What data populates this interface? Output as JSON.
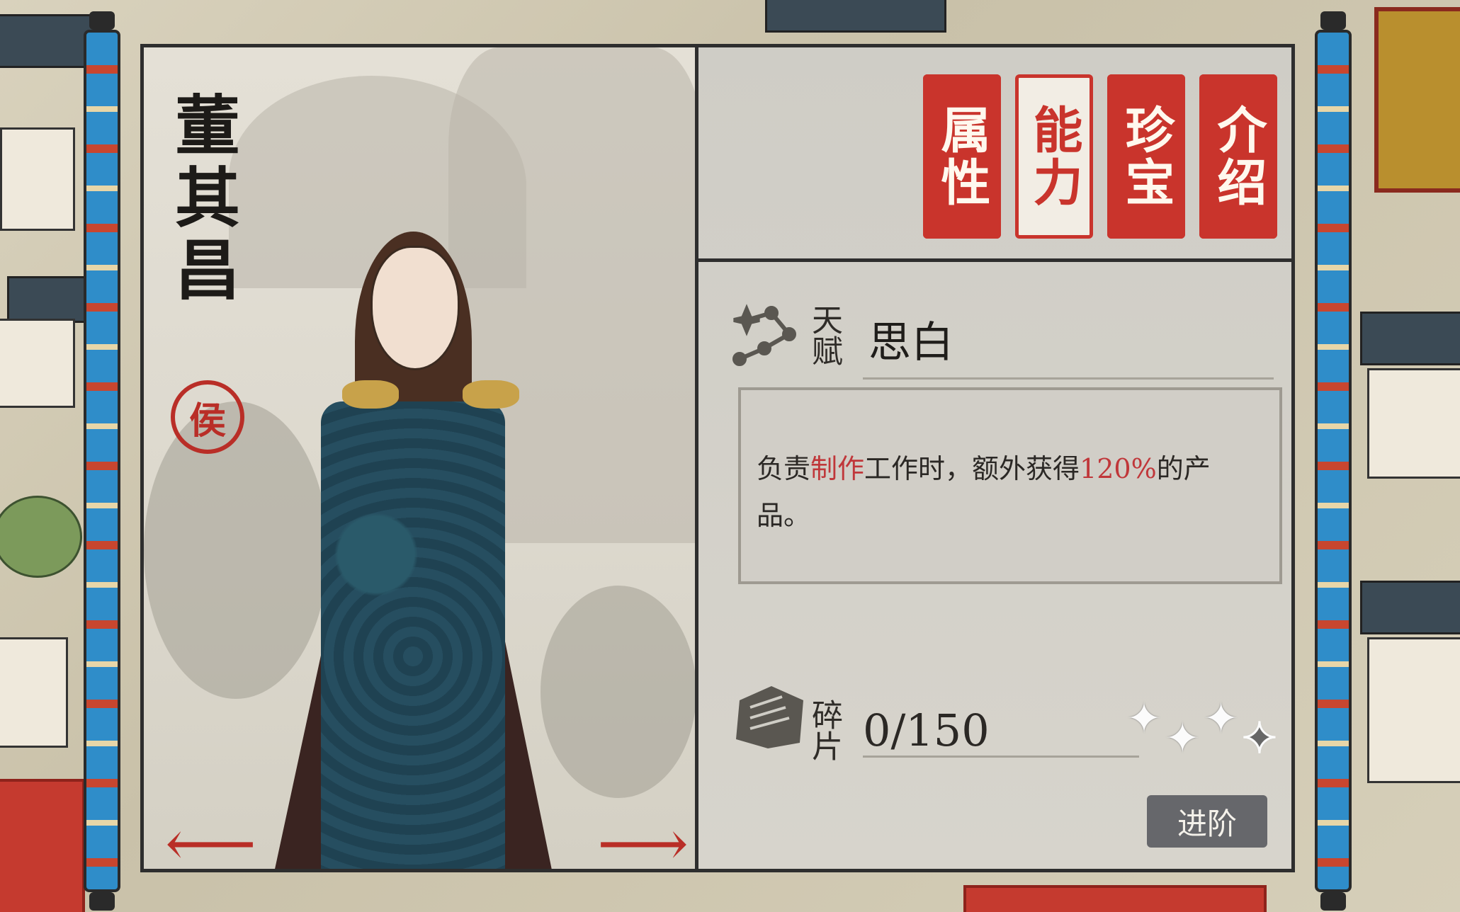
{
  "character": {
    "name": "董其昌",
    "rank_seal": "侯"
  },
  "tabs": [
    {
      "label": "属性",
      "active": false
    },
    {
      "label": "能力",
      "active": true
    },
    {
      "label": "珍宝",
      "active": false
    },
    {
      "label": "介绍",
      "active": false
    }
  ],
  "talent": {
    "label": "天赋",
    "name": "思白",
    "description": {
      "part1": "负责",
      "highlight1": "制作",
      "part2": "工作时，额外获得",
      "highlight2": "120%",
      "part3": "的产品。"
    }
  },
  "fragments": {
    "label": "碎片",
    "count": "0/150",
    "stars_filled": 3,
    "stars_total": 4
  },
  "advance_button": "进阶",
  "colors": {
    "accent_red": "#c9342c",
    "highlight_red": "#c0373a",
    "scroll_blue": "#2f8dc9"
  },
  "icons": {
    "talent": "constellation-icon",
    "fragments": "fragment-pages-icon",
    "prev": "left-arrow-icon",
    "next": "right-arrow-icon"
  }
}
